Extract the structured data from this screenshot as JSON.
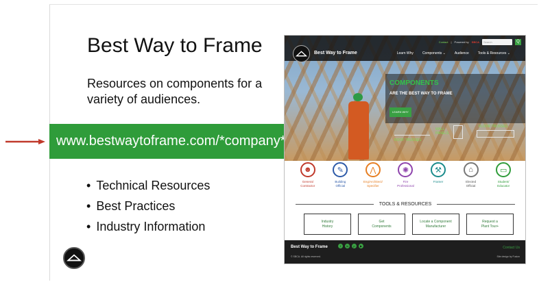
{
  "slide": {
    "title": "Best Way to Frame",
    "subtitle": "Resources on components for a variety of audiences.",
    "url": "www.bestwaytoframe.com/*company*",
    "bullets": [
      "Technical Resources",
      "Best Practices",
      "Industry Information"
    ]
  },
  "website": {
    "topbar": {
      "contact": "Contact",
      "divider": "|",
      "powered_by": "Powered by",
      "brand": "SBCA",
      "search_placeholder": "Search",
      "search_button": "Q"
    },
    "site_name": "Best Way to Frame",
    "nav": [
      "Learn Why",
      "Components ⌄",
      "Audience",
      "Tools & Resources ⌄"
    ],
    "hero": {
      "title": "COMPONENTS",
      "subtitle": "ARE THE BEST WAY TO FRAME",
      "cta": "LEARN WHY",
      "tags": {
        "wall_panels": "WALL\nPANELS",
        "floor_trusses": "FLOOR TRUSSES",
        "roof_trusses": "ROOF TRUSSES"
      }
    },
    "audiences": [
      {
        "label": "General\nContractor",
        "icon": "contractor-icon",
        "color": "#c0392b"
      },
      {
        "label": "Building\nOfficial",
        "icon": "document-icon",
        "color": "#2d5aa8"
      },
      {
        "label": "Eng/Architect/\nSpecifier",
        "icon": "compass-icon",
        "color": "#e67e22"
      },
      {
        "label": "Fire\nProfessional",
        "icon": "fire-icon",
        "color": "#8e44ad"
      },
      {
        "label": "Framer",
        "icon": "hammer-icon",
        "color": "#1a8b8b"
      },
      {
        "label": "Elected\nOfficial",
        "icon": "capitol-icon",
        "color": "#555555"
      },
      {
        "label": "Student/\nEducator",
        "icon": "book-icon",
        "color": "#2f9c3a"
      }
    ],
    "tools_heading": "TOOLS & RESOURCES",
    "tools": [
      "Industry\nHistory",
      "Get\nComponents",
      "Locate a Component\nManufacturer",
      "Request a\nPlant Tour+"
    ],
    "footer": {
      "site_name": "Best Way to Frame",
      "copyright": "© SBCA. All rights reserved.",
      "contact": "Contact Us",
      "design": "Site design by Fusion"
    }
  },
  "colors": {
    "accent": "#2f9c3a",
    "arrow": "#c0392b",
    "footer_bg": "#1e1e1e"
  }
}
